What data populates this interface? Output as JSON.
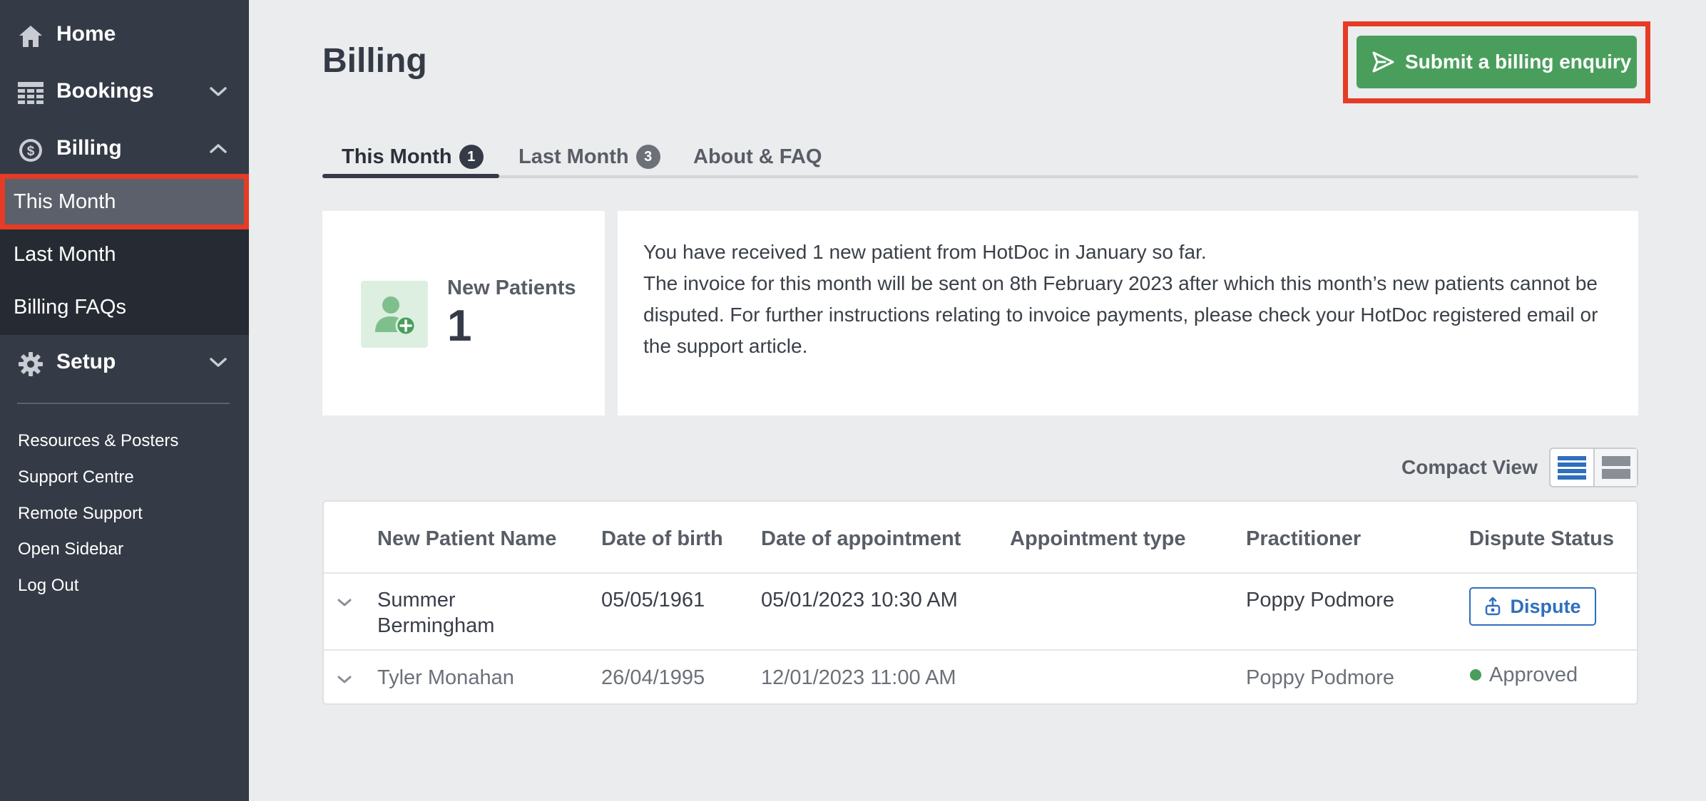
{
  "sidebar": {
    "nav": {
      "home": "Home",
      "bookings": "Bookings",
      "billing": "Billing",
      "setup": "Setup"
    },
    "billing_sub": {
      "this_month": "This Month",
      "last_month": "Last Month",
      "faqs": "Billing FAQs"
    },
    "footer": {
      "resources": "Resources & Posters",
      "support": "Support Centre",
      "remote": "Remote Support",
      "open_sidebar": "Open Sidebar",
      "logout": "Log Out"
    }
  },
  "header": {
    "title": "Billing",
    "enquiry_button": "Submit a billing enquiry"
  },
  "tabs": {
    "this_month": {
      "label": "This Month",
      "count": "1"
    },
    "last_month": {
      "label": "Last Month",
      "count": "3"
    },
    "about": {
      "label": "About & FAQ"
    }
  },
  "summary": {
    "new_patients_label": "New Patients",
    "new_patients_value": "1",
    "line1": "You have received 1 new patient from HotDoc in January so far.",
    "line2": "The invoice for this month will be sent on 8th February 2023 after which this month’s new patients cannot be disputed. For further instructions relating to invoice payments, please check your HotDoc registered email or the support article."
  },
  "view": {
    "compact_label": "Compact View"
  },
  "table": {
    "headers": {
      "name": "New Patient Name",
      "dob": "Date of birth",
      "appointment": "Date of appointment",
      "type": "Appointment type",
      "practitioner": "Practitioner",
      "status": "Dispute Status"
    },
    "rows": [
      {
        "name_line1": "Summer",
        "name_line2": "Bermingham",
        "dob": "05/05/1961",
        "appointment": "05/01/2023 10:30 AM",
        "type": "",
        "practitioner": "Poppy Podmore",
        "action": "Dispute"
      },
      {
        "name": "Tyler Monahan",
        "dob": "26/04/1995",
        "appointment": "12/01/2023 11:00 AM",
        "type": "",
        "practitioner": "Poppy Podmore",
        "status": "Approved"
      }
    ]
  },
  "colors": {
    "sidebar_bg": "#353b46",
    "accent_green": "#4a9e5c",
    "highlight_red": "#e63b24",
    "link_blue": "#2f6fbd"
  }
}
